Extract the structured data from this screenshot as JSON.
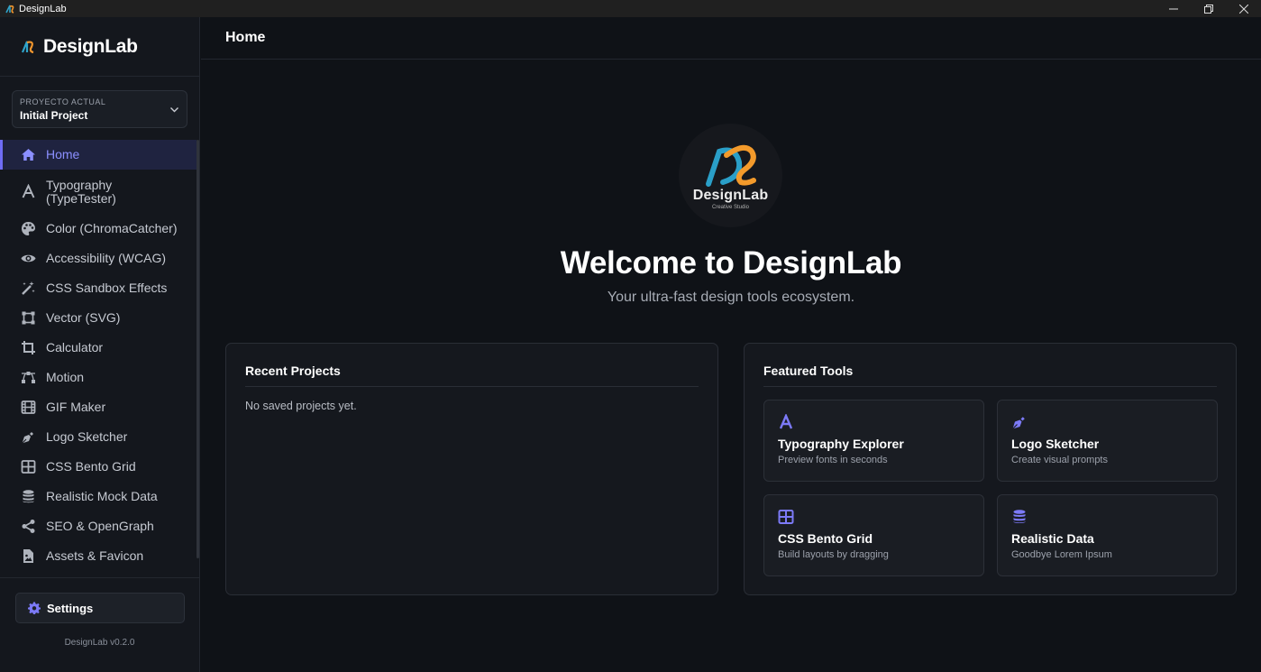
{
  "window": {
    "title": "DesignLab"
  },
  "sidebar": {
    "brand": "DesignLab",
    "project": {
      "label": "PROYECTO ACTUAL",
      "value": "Initial Project"
    },
    "items": [
      {
        "label": "Home",
        "icon": "home-icon"
      },
      {
        "label": "Typography (TypeTester)",
        "icon": "letter-a-icon"
      },
      {
        "label": "Color (ChromaCatcher)",
        "icon": "palette-icon"
      },
      {
        "label": "Accessibility (WCAG)",
        "icon": "eye-icon"
      },
      {
        "label": "CSS Sandbox Effects",
        "icon": "magic-wand-icon"
      },
      {
        "label": "Vector (SVG)",
        "icon": "vector-square-icon"
      },
      {
        "label": "Calculator",
        "icon": "crop-icon"
      },
      {
        "label": "Motion",
        "icon": "bezier-curve-icon"
      },
      {
        "label": "GIF Maker",
        "icon": "film-icon"
      },
      {
        "label": "Logo Sketcher",
        "icon": "pen-nib-icon"
      },
      {
        "label": "CSS Bento Grid",
        "icon": "grid-icon"
      },
      {
        "label": "Realistic Mock Data",
        "icon": "database-icon"
      },
      {
        "label": "SEO & OpenGraph",
        "icon": "share-icon"
      },
      {
        "label": "Assets & Favicon",
        "icon": "file-image-icon"
      }
    ],
    "settings_label": "Settings",
    "version": "DesignLab v0.2.0"
  },
  "main": {
    "page_title": "Home",
    "hero": {
      "logo_name": "DesignLab",
      "logo_sub": "Creative Studio",
      "title": "Welcome to DesignLab",
      "tagline": "Your ultra-fast design tools ecosystem."
    },
    "recent": {
      "title": "Recent Projects",
      "empty": "No saved projects yet."
    },
    "featured": {
      "title": "Featured Tools",
      "tools": [
        {
          "name": "Typography Explorer",
          "desc": "Preview fonts in seconds",
          "icon": "letter-a-icon"
        },
        {
          "name": "Logo Sketcher",
          "desc": "Create visual prompts",
          "icon": "pen-nib-icon"
        },
        {
          "name": "CSS Bento Grid",
          "desc": "Build layouts by dragging",
          "icon": "grid-icon"
        },
        {
          "name": "Realistic Data",
          "desc": "Goodbye Lorem Ipsum",
          "icon": "database-icon"
        }
      ]
    }
  },
  "colors": {
    "accent": "#6f6cf6",
    "background": "#0f1217",
    "sidebar": "#14171d",
    "card": "#15181e"
  }
}
